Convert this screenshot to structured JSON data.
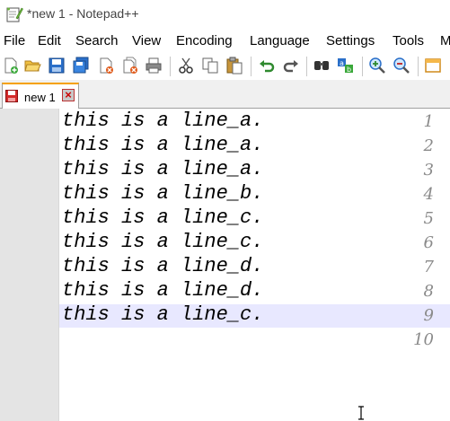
{
  "window": {
    "title": "*new 1 - Notepad++",
    "app_icon": "notepad-plus-plus-icon"
  },
  "menu": {
    "items": [
      {
        "label": "File"
      },
      {
        "label": "Edit"
      },
      {
        "label": "Search"
      },
      {
        "label": "View"
      },
      {
        "label": "Encoding"
      },
      {
        "label": "Language"
      },
      {
        "label": "Settings"
      },
      {
        "label": "Tools"
      },
      {
        "label": "M"
      }
    ]
  },
  "toolbar": {
    "buttons": [
      "new-file-icon",
      "open-file-icon",
      "save-icon",
      "save-all-icon",
      "close-icon",
      "close-all-icon",
      "print-icon",
      "cut-icon",
      "copy-icon",
      "paste-icon",
      "undo-icon",
      "redo-icon",
      "find-icon",
      "replace-icon",
      "zoom-in-icon",
      "zoom-out-icon",
      "sync-scroll-icon"
    ]
  },
  "tabs": [
    {
      "label": "new 1",
      "modified": true,
      "active": true
    }
  ],
  "editor": {
    "lines": [
      {
        "number": "1",
        "text": "this is a line_a."
      },
      {
        "number": "2",
        "text": "this is a line_a."
      },
      {
        "number": "3",
        "text": "this is a line_a."
      },
      {
        "number": "4",
        "text": "this is a line_b."
      },
      {
        "number": "5",
        "text": "this is a line_c."
      },
      {
        "number": "6",
        "text": "this is a line_c."
      },
      {
        "number": "7",
        "text": "this is a line_d."
      },
      {
        "number": "8",
        "text": "this is a line_d."
      },
      {
        "number": "9",
        "text": "this is a line_c."
      },
      {
        "number": "10",
        "text": ""
      }
    ],
    "current_line": "9"
  },
  "colors": {
    "caret_line": "#e8e8ff",
    "gutter": "#e4e4e4",
    "tab_accent": "#f5a100"
  }
}
